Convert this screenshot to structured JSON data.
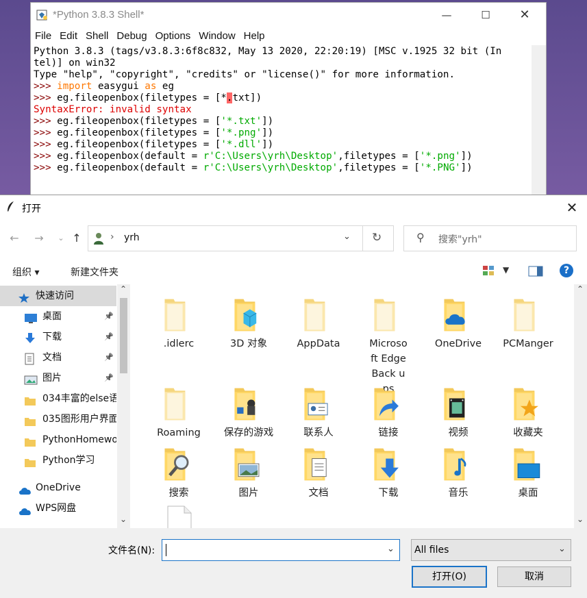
{
  "shell": {
    "title": "*Python 3.8.3 Shell*",
    "menu": [
      "File",
      "Edit",
      "Shell",
      "Debug",
      "Options",
      "Window",
      "Help"
    ],
    "lines": [
      [
        {
          "t": "Python 3.8.3 (tags/v3.8.3:6f8c832, May 13 2020, 22:20:19) [MSC v.1925 32 bit (In",
          "c": ""
        }
      ],
      [
        {
          "t": "tel)] on win32",
          "c": ""
        }
      ],
      [
        {
          "t": "Type \"help\", \"copyright\", \"credits\" or \"license()\" for more information.",
          "c": ""
        }
      ],
      [
        {
          "t": ">>> ",
          "c": "p"
        },
        {
          "t": "import",
          "c": "k"
        },
        {
          "t": " easygui ",
          "c": ""
        },
        {
          "t": "as",
          "c": "k"
        },
        {
          "t": " eg",
          "c": ""
        }
      ],
      [
        {
          "t": ">>> ",
          "c": "p"
        },
        {
          "t": "eg.fileopenbox(filetypes = [*",
          "c": ""
        },
        {
          "t": ".",
          "c": "hl"
        },
        {
          "t": "txt])",
          "c": ""
        }
      ],
      [
        {
          "t": "SyntaxError: invalid syntax",
          "c": "e"
        }
      ],
      [
        {
          "t": ">>> ",
          "c": "p"
        },
        {
          "t": "eg.fileopenbox(filetypes = [",
          "c": ""
        },
        {
          "t": "'*.txt'",
          "c": "s"
        },
        {
          "t": "])",
          "c": ""
        }
      ],
      [
        {
          "t": ">>> ",
          "c": "p"
        },
        {
          "t": "eg.fileopenbox(filetypes = [",
          "c": ""
        },
        {
          "t": "'*.png'",
          "c": "s"
        },
        {
          "t": "])",
          "c": ""
        }
      ],
      [
        {
          "t": ">>> ",
          "c": "p"
        },
        {
          "t": "eg.fileopenbox(filetypes = [",
          "c": ""
        },
        {
          "t": "'*.dll'",
          "c": "s"
        },
        {
          "t": "])",
          "c": ""
        }
      ],
      [
        {
          "t": ">>> ",
          "c": "p"
        },
        {
          "t": "eg.fileopenbox(default = ",
          "c": ""
        },
        {
          "t": "r'C:\\Users\\yrh\\Desktop'",
          "c": "s"
        },
        {
          "t": ",filetypes = [",
          "c": ""
        },
        {
          "t": "'*.png'",
          "c": "s"
        },
        {
          "t": "])",
          "c": ""
        }
      ],
      [
        {
          "t": ">>> ",
          "c": "p"
        },
        {
          "t": "eg.fileopenbox(default = ",
          "c": ""
        },
        {
          "t": "r'C:\\Users\\yrh\\Desktop'",
          "c": "s"
        },
        {
          "t": ",filetypes = [",
          "c": ""
        },
        {
          "t": "'*.PNG'",
          "c": "s"
        },
        {
          "t": "])",
          "c": ""
        }
      ]
    ]
  },
  "dialog": {
    "title": "打开",
    "address": {
      "separator": "›",
      "location": "yrh"
    },
    "search_placeholder": "搜索\"yrh\"",
    "organize": "组织 ▾",
    "new_folder": "新建文件夹",
    "help": "?",
    "sidebar": [
      {
        "label": "快速访问",
        "icon": "star-icon",
        "pin": false,
        "selected": true
      },
      {
        "label": "桌面",
        "icon": "desktop-icon",
        "pin": true
      },
      {
        "label": "下载",
        "icon": "download-icon",
        "pin": true
      },
      {
        "label": "文档",
        "icon": "document-icon",
        "pin": true
      },
      {
        "label": "图片",
        "icon": "picture-icon",
        "pin": true
      },
      {
        "label": "034丰富的else语",
        "icon": "folder-icon",
        "pin": false
      },
      {
        "label": "035图形用户界面",
        "icon": "folder-icon",
        "pin": false
      },
      {
        "label": "PythonHomewo",
        "icon": "folder-icon",
        "pin": false
      },
      {
        "label": "Python学习",
        "icon": "folder-icon",
        "pin": false
      },
      {
        "label": "OneDrive",
        "icon": "cloud-icon",
        "pin": false
      },
      {
        "label": "WPS网盘",
        "icon": "cloud-icon",
        "pin": false
      }
    ],
    "items": [
      {
        "name": ".idlerc",
        "icon": "folder-icon"
      },
      {
        "name": "3D 对象",
        "icon": "3d-objects-folder-icon"
      },
      {
        "name": "AppData",
        "icon": "folder-icon"
      },
      {
        "name": "Microsoft EdgeBack ups",
        "icon": "folder-icon"
      },
      {
        "name": "OneDrive",
        "icon": "onedrive-folder-icon"
      },
      {
        "name": "PCManger",
        "icon": "folder-icon"
      },
      {
        "name": "Roaming",
        "icon": "folder-icon"
      },
      {
        "name": "保存的游戏",
        "icon": "saved-games-folder-icon"
      },
      {
        "name": "联系人",
        "icon": "contacts-folder-icon"
      },
      {
        "name": "链接",
        "icon": "links-folder-icon"
      },
      {
        "name": "视频",
        "icon": "videos-folder-icon"
      },
      {
        "name": "收藏夹",
        "icon": "favorites-folder-icon"
      },
      {
        "name": "搜索",
        "icon": "searches-folder-icon"
      },
      {
        "name": "图片",
        "icon": "pictures-folder-icon"
      },
      {
        "name": "文档",
        "icon": "documents-folder-icon"
      },
      {
        "name": "下载",
        "icon": "downloads-folder-icon"
      },
      {
        "name": "音乐",
        "icon": "music-folder-icon"
      },
      {
        "name": "桌面",
        "icon": "desktop-folder-icon"
      },
      {
        "name": "",
        "icon": "file-icon"
      }
    ],
    "filename_label": "文件名(N):",
    "filename_value": "",
    "filter": "All files",
    "open_button": "打开(O)",
    "cancel_button": "取消"
  }
}
